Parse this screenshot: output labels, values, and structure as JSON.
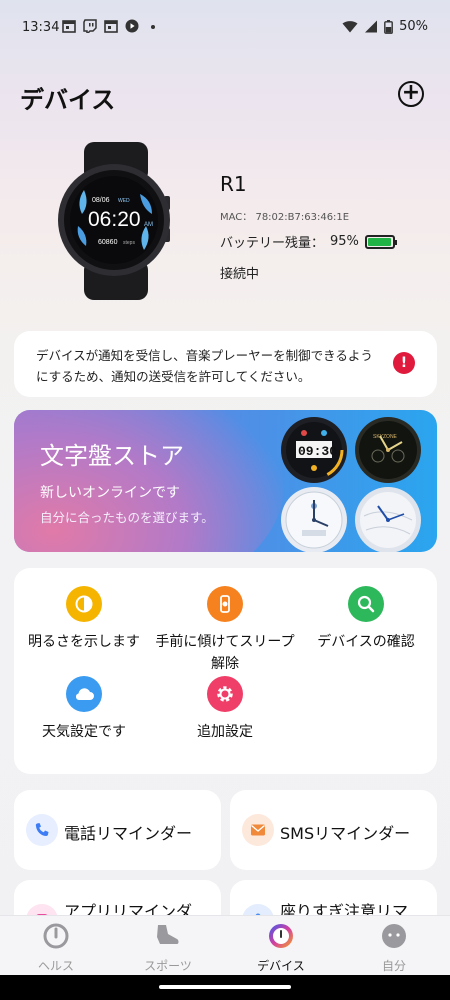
{
  "status_bar": {
    "time": "13:34",
    "battery_percent": "50%",
    "left_icons": [
      "calendar-icon",
      "twitch-icon",
      "calendar-icon",
      "youtube-icon",
      "dot-icon"
    ],
    "right_icons": [
      "wifi-icon",
      "signal-icon",
      "battery-icon"
    ]
  },
  "header": {
    "title": "デバイス",
    "add_icon": "plus-circle-icon"
  },
  "device": {
    "name": "R1",
    "mac": "MAC： 78:02:B7:63:46:1E",
    "battery_label": "バッテリー残量：",
    "battery_value": "95%",
    "battery_level": 0.95,
    "status": "接続中",
    "watch_screen": {
      "date": "08/06",
      "weekday": "WED",
      "time": "06:20",
      "ampm": "AM",
      "steps": "60860",
      "steps_unit": "steps"
    }
  },
  "notice": {
    "text": "デバイスが通知を受信し、音楽プレーヤーを制御できるようにするため、通知の送受信を許可してください。",
    "icon": "alert-icon"
  },
  "watchface_store": {
    "title": "文字盤ストア",
    "subtitle": "新しいオンラインです",
    "description": "自分に合ったものを選びます。",
    "preview_time": "09:30",
    "preview_brand": "SKYZONE"
  },
  "settings": [
    {
      "label": "明るさを示します",
      "icon": "brightness-icon",
      "color": "#f5b400"
    },
    {
      "label": "手前に傾けてスリープ解除",
      "icon": "wrist-raise-icon",
      "color": "#f5821f"
    },
    {
      "label": "デバイスの確認",
      "icon": "search-icon",
      "color": "#2eb85c"
    },
    {
      "label": "天気設定です",
      "icon": "cloud-icon",
      "color": "#3a9bf0"
    },
    {
      "label": "追加設定",
      "icon": "gear-icon",
      "color": "#ef3f68"
    }
  ],
  "reminders": [
    {
      "label": "電話リマインダー",
      "icon": "phone-icon",
      "color": "#3d7cf5"
    },
    {
      "label": "SMSリマインダー",
      "icon": "envelope-icon",
      "color": "#f08a3a"
    },
    {
      "label": "アプリリマインダ",
      "icon": "app-icon",
      "color": "#e84b9c"
    },
    {
      "label": "座りすぎ注意リマ",
      "icon": "person-icon",
      "color": "#4a8ef0"
    }
  ],
  "bottom_nav": [
    {
      "label": "ヘルス",
      "icon": "health-icon",
      "active": false
    },
    {
      "label": "スポーツ",
      "icon": "shoe-icon",
      "active": false
    },
    {
      "label": "デバイス",
      "icon": "watch-icon",
      "active": true
    },
    {
      "label": "自分",
      "icon": "profile-icon",
      "active": false
    }
  ]
}
